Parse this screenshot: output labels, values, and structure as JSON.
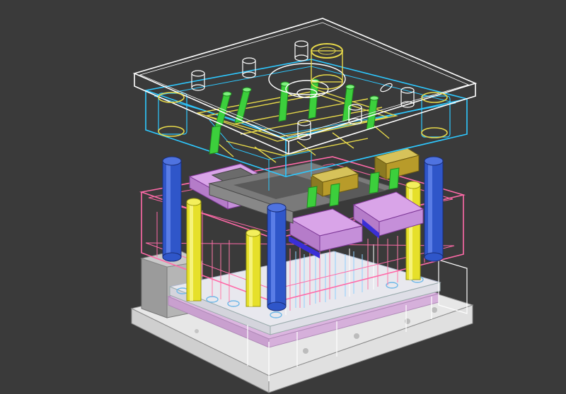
{
  "scene": {
    "subject": "injection-mold-assembly-3d-model",
    "render_mode": "wireframe-shaded-mix",
    "background_color": "#3a3a3a"
  },
  "colors": {
    "top_clamp_plate": "#ffffff",
    "cavity_plate": "#2ec8ff",
    "core_plate": "#ff6aa8",
    "guide_pillar": "#2f56c9",
    "support_pillar": "#e6e02a",
    "slider_block": "#d9a4e8",
    "wedge_block": "#b89b2a",
    "hot_runner_nozzle": "#3ccf3c",
    "runner_channel": "#e6d84a",
    "base_plate": "#e9e9e9",
    "ejector_plate": "#dcb6e0"
  }
}
